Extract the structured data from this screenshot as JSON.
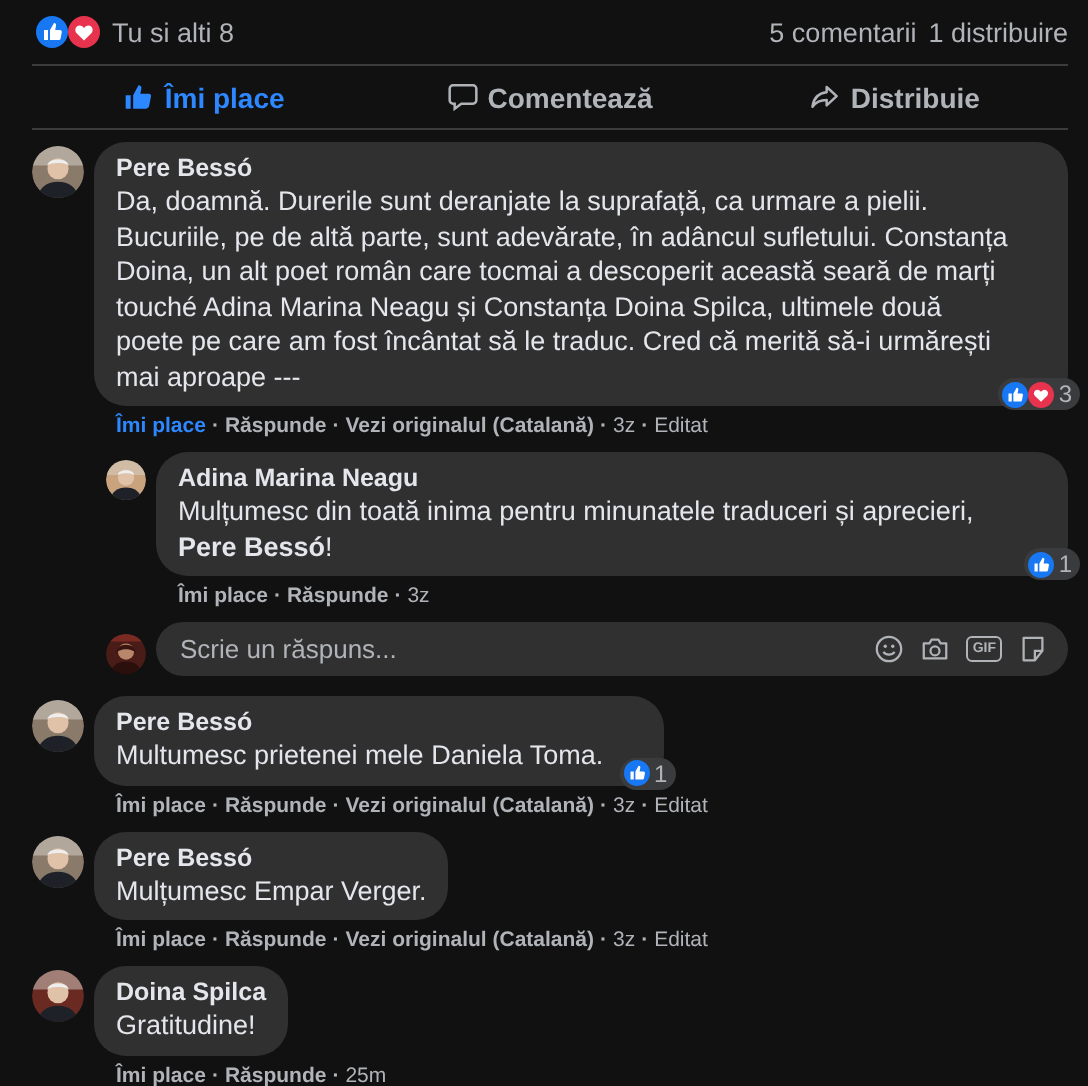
{
  "summary": {
    "reactions": {
      "like": true,
      "love": true
    },
    "text": "Tu si alti 8",
    "comments": "5 comentarii",
    "shares": "1 distribuire"
  },
  "action_bar": [
    {
      "kind": "like",
      "label": "Îmi place",
      "selected": true
    },
    {
      "kind": "comment",
      "label": "Comentează",
      "selected": false
    },
    {
      "kind": "share",
      "label": "Distribuie",
      "selected": false
    }
  ],
  "separator": "·",
  "comments": [
    {
      "kind": "comment",
      "name": "Pere Bessó",
      "text": "Da, doamnă. Durerile sunt deranjate la suprafață, ca urmare a pielii. Bucuriile, pe de altă parte, sunt adevărate, în adâncul sufletului. Constanța Doina, un alt poet român care tocmai a descoperit această seară de marți touché Adina Marina Neagu și Constanța Doina Spilca, ultimele două poete pe care am fost încântat să le traduc. Cred că merită să-i urmărești mai aproape ---",
      "liked": true,
      "actions": [
        "Îmi place",
        "Răspunde",
        "Vezi originalul (Catalană)",
        "3z",
        "Editat"
      ],
      "reactions": {
        "like": true,
        "love": true,
        "count": "3"
      }
    },
    {
      "kind": "reply",
      "name": "Adina Marina Neagu",
      "text": "Mulțumesc din toată inima pentru minunatele traduceri și aprecieri, **Pere Bessó**!",
      "liked": false,
      "actions": [
        "Îmi place",
        "Răspunde",
        "3z"
      ],
      "reactions": {
        "like": true,
        "count": "1"
      }
    },
    {
      "kind": "reply_field",
      "placeholder": "Scrie un răspuns...",
      "gif_label": "GIF"
    },
    {
      "kind": "comment",
      "name": "Pere Bessó",
      "text": "Multumesc prietenei mele Daniela Toma.",
      "liked": false,
      "actions": [
        "Îmi place",
        "Răspunde",
        "Vezi originalul (Catalană)",
        "3z",
        "Editat"
      ],
      "reactions": {
        "like": true,
        "count": "1"
      }
    },
    {
      "kind": "comment",
      "name": "Pere Bessó",
      "text": "Mulțumesc Empar Verger.",
      "liked": false,
      "actions": [
        "Îmi place",
        "Răspunde",
        "Vezi originalul (Catalană)",
        "3z",
        "Editat"
      ]
    },
    {
      "kind": "comment",
      "name": "Doina Spilca",
      "text": "Gratitudine!",
      "liked": false,
      "actions": [
        "Îmi place",
        "Răspunde",
        "25m"
      ]
    }
  ]
}
